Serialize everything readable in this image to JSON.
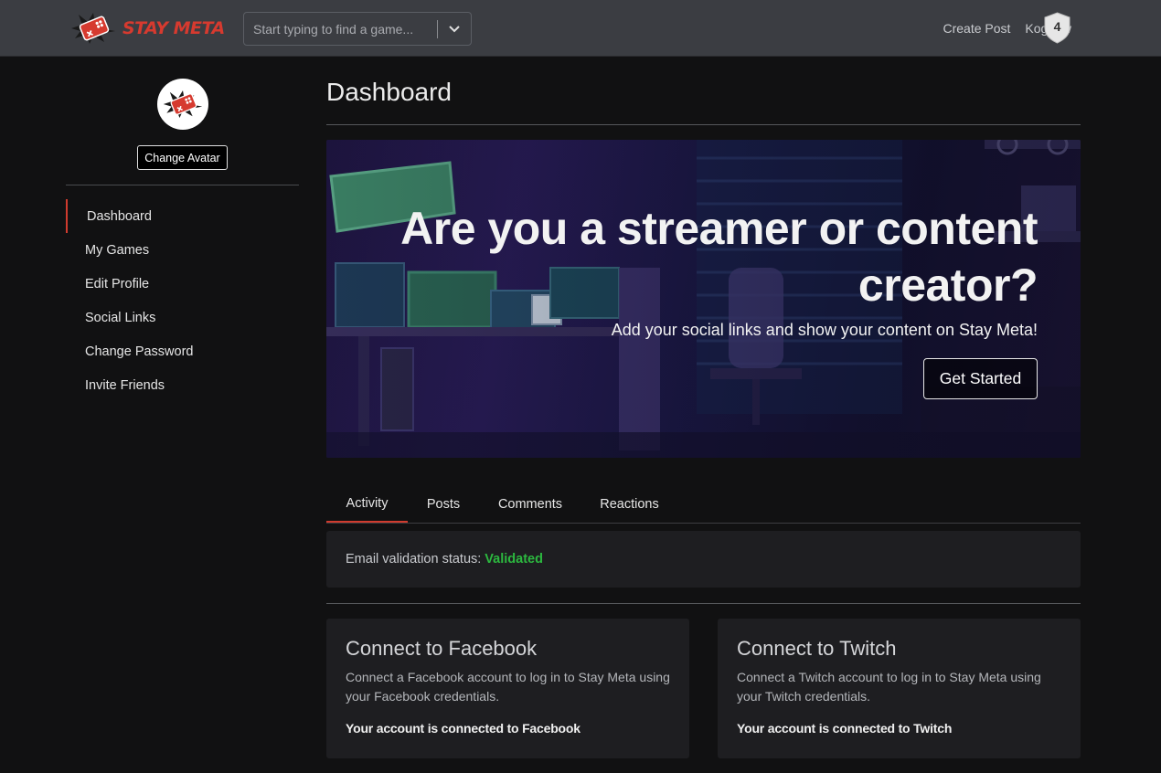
{
  "header": {
    "brand": "STAY META",
    "search_placeholder": "Start typing to find a game...",
    "nav": {
      "create_post": "Create Post",
      "username": "Kogpaw"
    },
    "badge_level": "4"
  },
  "sidebar": {
    "change_avatar_label": "Change Avatar",
    "items": [
      {
        "label": "Dashboard",
        "active": true
      },
      {
        "label": "My Games"
      },
      {
        "label": "Edit Profile"
      },
      {
        "label": "Social Links"
      },
      {
        "label": "Change Password"
      },
      {
        "label": "Invite Friends"
      }
    ]
  },
  "main": {
    "title": "Dashboard",
    "hero": {
      "heading": "Are you a streamer or content creator?",
      "subtitle": "Add your social links and show your content on Stay Meta!",
      "button_label": "Get Started"
    },
    "tabs": [
      {
        "label": "Activity",
        "active": true
      },
      {
        "label": "Posts"
      },
      {
        "label": "Comments"
      },
      {
        "label": "Reactions"
      }
    ],
    "email_status": {
      "label": "Email validation status:",
      "value": "Validated"
    },
    "connect": [
      {
        "title": "Connect to Facebook",
        "description": "Connect a Facebook account to log in to Stay Meta using your Facebook credentials.",
        "status": "Your account is connected to Facebook"
      },
      {
        "title": "Connect to Twitch",
        "description": "Connect a Twitch account to log in to Stay Meta using your Twitch credentials.",
        "status": "Your account is connected to Twitch"
      }
    ]
  },
  "colors": {
    "accent": "#d03b2e",
    "validated": "#2cb83f",
    "header_bg": "#3b3d42",
    "page_bg": "#111112",
    "card_bg": "#1e1e21"
  },
  "icons": {
    "logo": "gamepad-logo-icon",
    "dropdown": "chevron-down-icon",
    "badge": "shield-icon"
  }
}
